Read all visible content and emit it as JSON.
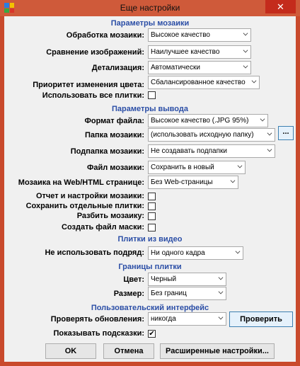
{
  "window": {
    "title": "Еще настройки",
    "close": "✕"
  },
  "sections": {
    "mosaic": "Параметры мозаики",
    "output": "Параметры вывода",
    "video": "Плитки из видео",
    "borders": "Границы плитки",
    "ui": "Пользовательский интерфейс"
  },
  "mosaic": {
    "processing_label": "Обработка мозаики:",
    "processing_value": "Высокое качество",
    "comparison_label": "Сравнение изображений:",
    "comparison_value": "Наилучшее качество",
    "detail_label": "Детализация:",
    "detail_value": "Автоматически",
    "color_priority_label": "Приоритет изменения цвета:",
    "color_priority_value": "Сбалансированное качество",
    "use_all_label": "Использовать все плитки:",
    "use_all_checked": ""
  },
  "output": {
    "format_label": "Формат файла:",
    "format_value": "Высокое качество (.JPG  95%)",
    "folder_label": "Папка мозаики:",
    "folder_value": "(использовать исходную папку)",
    "browse": "...",
    "subfolder_label": "Подпапка мозаики:",
    "subfolder_value": "Не создавать подпапки",
    "file_label": "Файл мозаики:",
    "file_value": "Сохранить в новый",
    "web_label": "Мозаика на Web/HTML странице:",
    "web_value": "Без Web-страницы",
    "report_label": "Отчет и настройки мозаики:",
    "report_checked": "",
    "save_tiles_label": "Сохранить отдельные плитки:",
    "save_tiles_checked": "",
    "split_label": "Разбить мозаику:",
    "split_checked": "",
    "mask_label": "Создать файл маски:",
    "mask_checked": ""
  },
  "video": {
    "repeat_label": "Не использовать подряд:",
    "repeat_value": "Ни одного кадра"
  },
  "borders": {
    "color_label": "Цвет:",
    "color_value": "Черный",
    "size_label": "Размер:",
    "size_value": "Без границ"
  },
  "ui": {
    "updates_label": "Проверять обновления:",
    "updates_value": "никогда",
    "check_button": "Проверить",
    "hints_label": "Показывать подсказки:",
    "hints_checked": "✔"
  },
  "buttons": {
    "ok": "OK",
    "cancel": "Отмена",
    "advanced": "Расширенные настройки..."
  },
  "colors": {
    "titlebar": "#cf5a3a",
    "section": "#2b4ea6",
    "close": "#c42b1c"
  }
}
